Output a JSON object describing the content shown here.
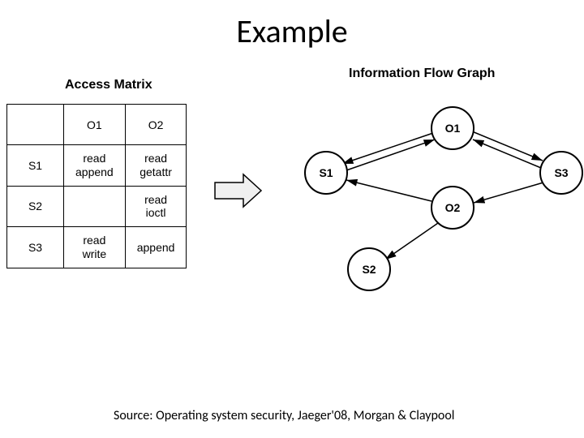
{
  "title": "Example",
  "matrix": {
    "title": "Access Matrix",
    "cols": [
      "O1",
      "O2"
    ],
    "rows": [
      "S1",
      "S2",
      "S3"
    ],
    "cells": {
      "r0c0": [
        "read",
        "append"
      ],
      "r0c1": [
        "read",
        "getattr"
      ],
      "r1c0": [],
      "r1c1": [
        "read",
        "ioctl"
      ],
      "r2c0": [
        "read",
        "write"
      ],
      "r2c1": [
        "append"
      ]
    }
  },
  "graph": {
    "title": "Information Flow Graph",
    "nodes": {
      "s1": "S1",
      "s2": "S2",
      "s3": "S3",
      "o1": "O1",
      "o2": "O2"
    }
  },
  "source": "Source: Operating system security, Jaeger'08, Morgan & Claypool"
}
